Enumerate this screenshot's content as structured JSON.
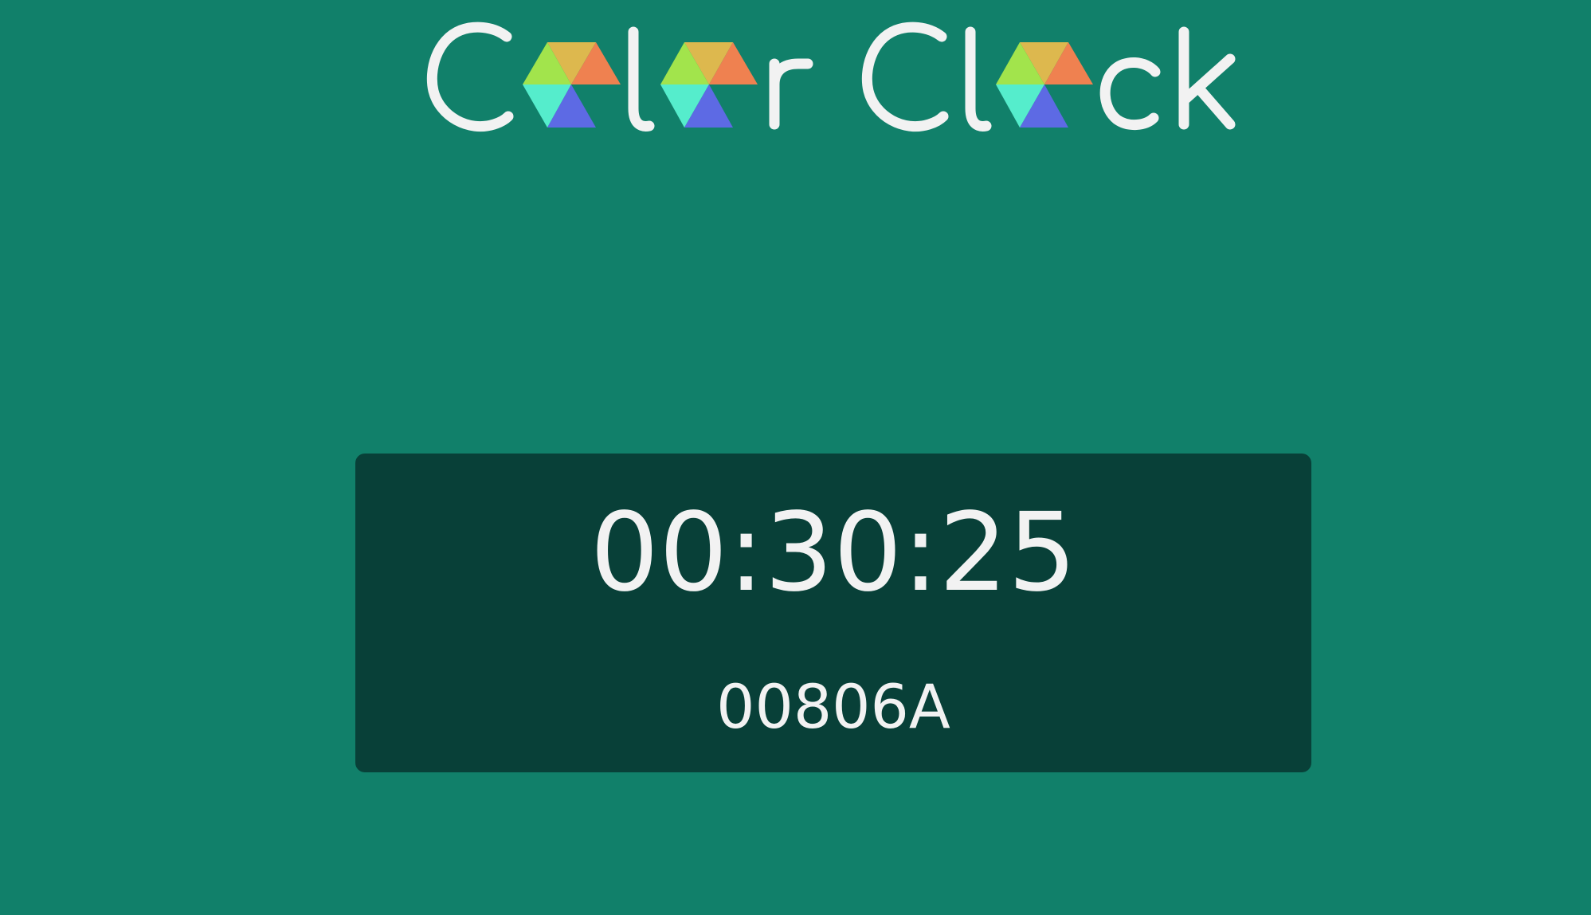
{
  "app": {
    "title": "Color Clock"
  },
  "theme": {
    "background": "#11806A",
    "panel": "#084038",
    "text": "#F2F2F2",
    "logo_colors": {
      "yellow": "#DDB84E",
      "green": "#A2E44C",
      "orange": "#EF8150",
      "cyan": "#55EDCC",
      "blue": "#5D6AE4"
    }
  },
  "clock": {
    "time": "00:30:25",
    "hex": "00806A"
  }
}
